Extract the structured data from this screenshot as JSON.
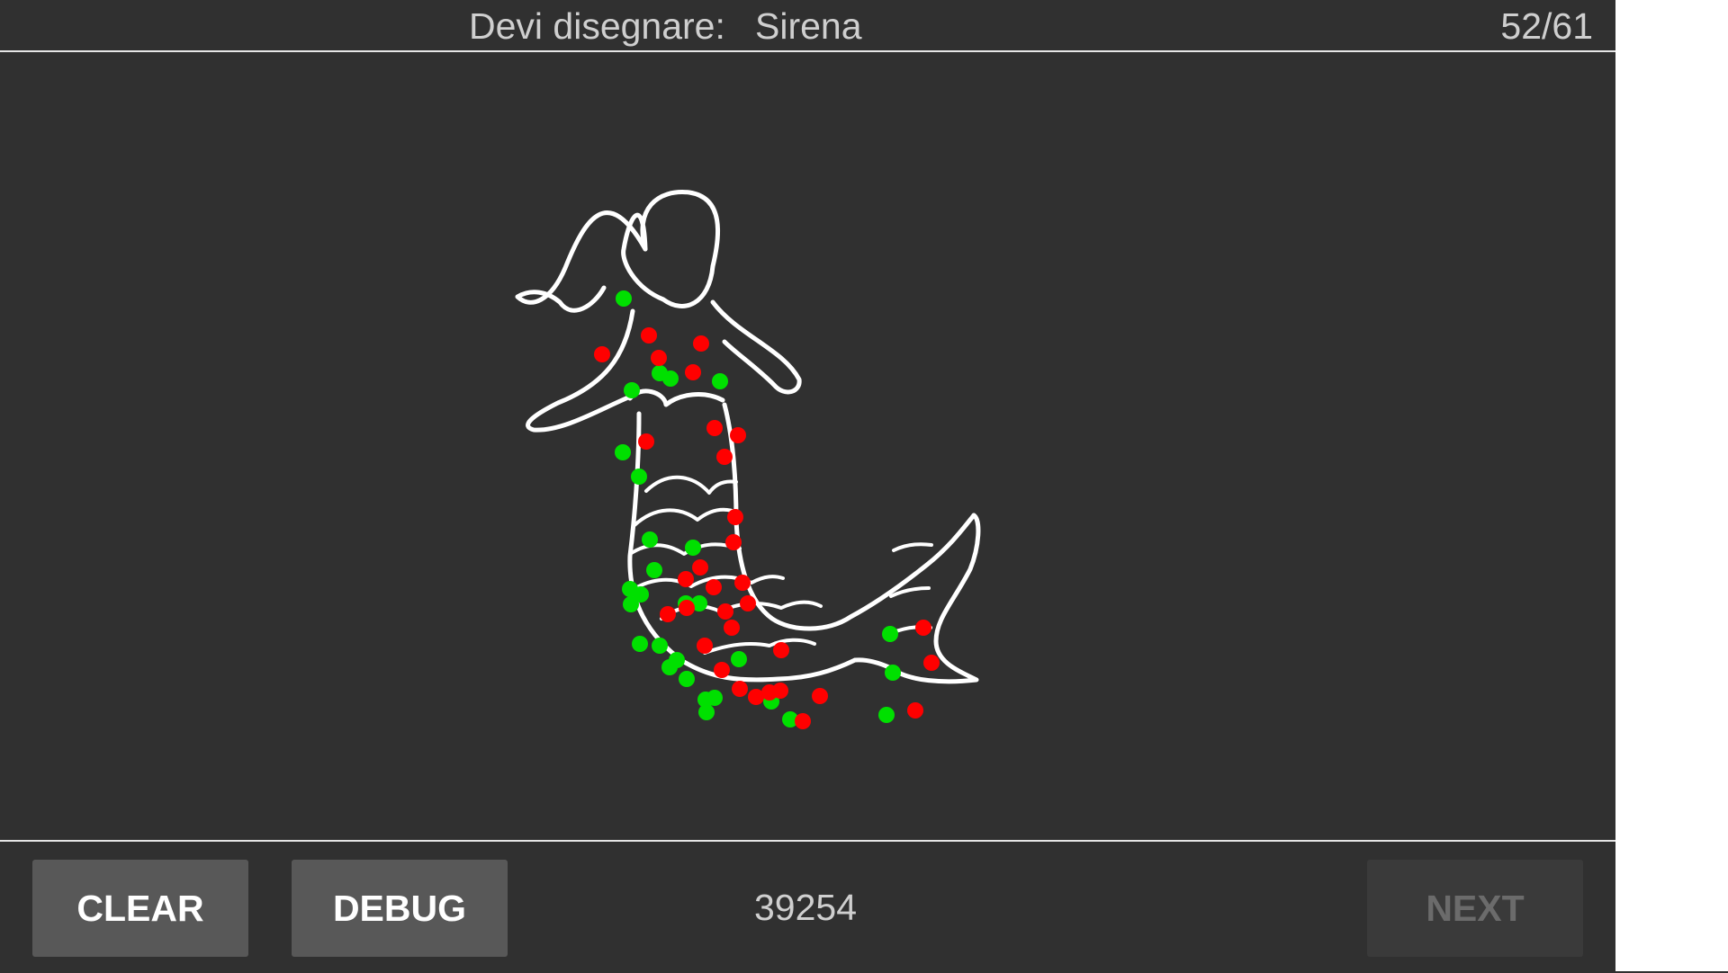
{
  "header": {
    "prompt_label": "Devi disegnare:",
    "prompt_word": "Sirena",
    "counter": "52/61"
  },
  "footer": {
    "clear_label": "CLEAR",
    "debug_label": "DEBUG",
    "score": "39254",
    "next_label": "NEXT"
  },
  "colors": {
    "background": "#303030",
    "stroke": "#ffffff",
    "point_green": "#00e000",
    "point_red": "#ff0000"
  }
}
